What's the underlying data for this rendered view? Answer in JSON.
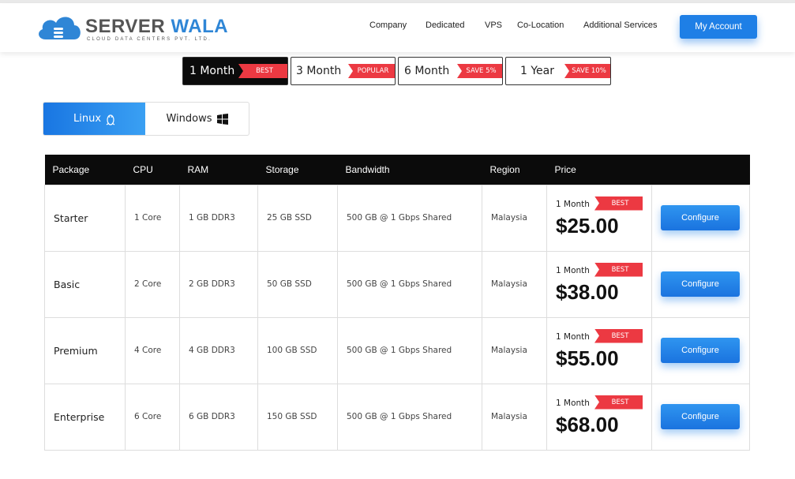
{
  "brand": {
    "name_part1": "SERVER",
    "name_part2": "WALA",
    "tagline": "CLOUD DATA CENTERS PVT. LTD."
  },
  "nav": [
    "Company",
    "Dedicated",
    "VPS",
    "Co-Location",
    "Additional Services"
  ],
  "account_label": "My Account",
  "periods": [
    {
      "label": "1 Month",
      "tag": "BEST",
      "active": true
    },
    {
      "label": "3 Month",
      "tag": "POPULAR",
      "active": false
    },
    {
      "label": "6 Month",
      "tag": "SAVE 5%",
      "active": false
    },
    {
      "label": "1 Year",
      "tag": "SAVE 10%",
      "active": false
    }
  ],
  "os_tabs": [
    {
      "label": "Linux",
      "icon": "linux-icon",
      "active": true
    },
    {
      "label": "Windows",
      "icon": "windows-icon",
      "active": false
    }
  ],
  "table": {
    "headers": [
      "Package",
      "CPU",
      "RAM",
      "Storage",
      "Bandwidth",
      "Region",
      "Price",
      ""
    ],
    "rows": [
      {
        "package": "Starter",
        "cpu": "1 Core",
        "ram": "1 GB DDR3",
        "storage": "25 GB SSD",
        "bandwidth": "500 GB @ 1 Gbps Shared",
        "region": "Malaysia",
        "period": "1 Month",
        "tag": "BEST",
        "price": "$25.00",
        "action": "Configure"
      },
      {
        "package": "Basic",
        "cpu": "2 Core",
        "ram": "2 GB DDR3",
        "storage": "50 GB SSD",
        "bandwidth": "500 GB @ 1 Gbps Shared",
        "region": "Malaysia",
        "period": "1 Month",
        "tag": "BEST",
        "price": "$38.00",
        "action": "Configure"
      },
      {
        "package": "Premium",
        "cpu": "4 Core",
        "ram": "4 GB DDR3",
        "storage": "100 GB SSD",
        "bandwidth": "500 GB @ 1 Gbps Shared",
        "region": "Malaysia",
        "period": "1 Month",
        "tag": "BEST",
        "price": "$55.00",
        "action": "Configure"
      },
      {
        "package": "Enterprise",
        "cpu": "6 Core",
        "ram": "6 GB DDR3",
        "storage": "150 GB SSD",
        "bandwidth": "500 GB @ 1 Gbps Shared",
        "region": "Malaysia",
        "period": "1 Month",
        "tag": "BEST",
        "price": "$68.00",
        "action": "Configure"
      }
    ]
  },
  "colors": {
    "accent": "#1e7fe6",
    "tag_red": "#ec3942",
    "dark": "#0b0b0b"
  }
}
